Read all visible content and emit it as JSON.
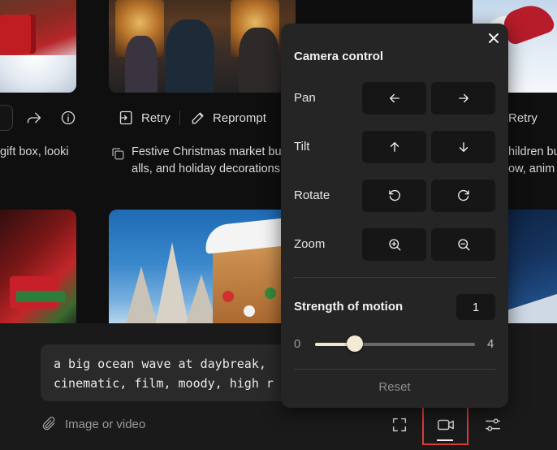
{
  "cards": {
    "left": {
      "caption": "gift box, looki"
    },
    "middle": {
      "retry_label": "Retry",
      "reprompt_label": "Reprompt",
      "caption_line1": "Festive Christmas market bu",
      "caption_line2": "alls, and holiday decorations"
    },
    "right": {
      "retry_label": "Retry",
      "caption_line1": "hildren bu",
      "caption_line2": "ow, anim"
    }
  },
  "prompt": {
    "text": "a big ocean wave at daybreak,\ncinematic, film, moody, high r",
    "attach_label": "Image or video"
  },
  "annotation": {
    "step": "3",
    "color": "#e03a36"
  },
  "camera_panel": {
    "title": "Camera control",
    "rows": [
      {
        "label": "Pan",
        "buttons": [
          "arrow-left-icon",
          "arrow-right-icon"
        ]
      },
      {
        "label": "Tilt",
        "buttons": [
          "arrow-up-icon",
          "arrow-down-icon"
        ]
      },
      {
        "label": "Rotate",
        "buttons": [
          "rotate-ccw-icon",
          "rotate-cw-icon"
        ]
      },
      {
        "label": "Zoom",
        "buttons": [
          "zoom-in-icon",
          "zoom-out-icon"
        ]
      }
    ],
    "strength": {
      "label": "Strength of motion",
      "value": "1",
      "min": "0",
      "max": "4",
      "fraction": 0.25
    },
    "reset_label": "Reset"
  }
}
